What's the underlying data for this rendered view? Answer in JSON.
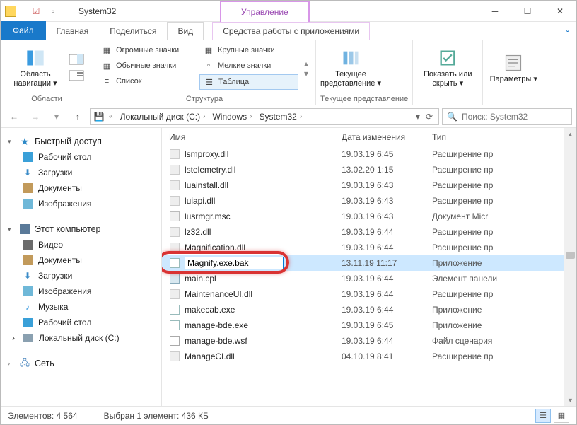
{
  "title": {
    "app_name": "System32",
    "context_group": "Управление",
    "context_tab": "Средства работы с приложениями"
  },
  "tabs": {
    "file": "Файл",
    "home": "Главная",
    "share": "Поделиться",
    "view": "Вид"
  },
  "ribbon": {
    "panes_group_label": "Области",
    "panes_btn": "Область навигации",
    "layout_group_label": "Структура",
    "layouts": {
      "huge": "Огромные значки",
      "large": "Крупные значки",
      "medium": "Обычные значки",
      "small": "Мелкие значки",
      "list": "Список",
      "table": "Таблица"
    },
    "currentview_group_label": "Текущее представление",
    "currentview_btn": "Текущее представление",
    "showhide_btn": "Показать или скрыть",
    "options_btn": "Параметры"
  },
  "breadcrumb": {
    "drive": "Локальный диск (C:)",
    "p1": "Windows",
    "p2": "System32"
  },
  "search": {
    "placeholder": "Поиск: System32"
  },
  "nav": {
    "quick": "Быстрый доступ",
    "quick_items": {
      "desktop": "Рабочий стол",
      "downloads": "Загрузки",
      "documents": "Документы",
      "pictures": "Изображения"
    },
    "thispc": "Этот компьютер",
    "pc_items": {
      "videos": "Видео",
      "documents": "Документы",
      "downloads": "Загрузки",
      "pictures": "Изображения",
      "music": "Музыка",
      "desktop": "Рабочий стол",
      "cdrive": "Локальный диск (C:)"
    },
    "network": "Сеть"
  },
  "columns": {
    "name": "Имя",
    "date": "Дата изменения",
    "type": "Тип"
  },
  "files": [
    {
      "name": "lsmproxy.dll",
      "date": "19.03.19 6:45",
      "type": "Расширение пр",
      "icon": "dll"
    },
    {
      "name": "lstelemetry.dll",
      "date": "13.02.20 1:15",
      "type": "Расширение пр",
      "icon": "dll"
    },
    {
      "name": "luainstall.dll",
      "date": "19.03.19 6:43",
      "type": "Расширение пр",
      "icon": "dll"
    },
    {
      "name": "luiapi.dll",
      "date": "19.03.19 6:43",
      "type": "Расширение пр",
      "icon": "dll"
    },
    {
      "name": "lusrmgr.msc",
      "date": "19.03.19 6:43",
      "type": "Документ Micr",
      "icon": "msc"
    },
    {
      "name": "lz32.dll",
      "date": "19.03.19 6:44",
      "type": "Расширение пр",
      "icon": "dll"
    },
    {
      "name": "Magnification.dll",
      "date": "19.03.19 6:44",
      "type": "Расширение пр",
      "icon": "dll"
    },
    {
      "name": "Magnify.exe.bak",
      "date": "13.11.19 11:17",
      "type": "Приложение",
      "icon": "exe",
      "renaming": true,
      "selected": true,
      "highlight": true
    },
    {
      "name": "main.cpl",
      "date": "19.03.19 6:44",
      "type": "Элемент панели",
      "icon": "cpl"
    },
    {
      "name": "MaintenanceUI.dll",
      "date": "19.03.19 6:44",
      "type": "Расширение пр",
      "icon": "dll"
    },
    {
      "name": "makecab.exe",
      "date": "19.03.19 6:44",
      "type": "Приложение",
      "icon": "exe"
    },
    {
      "name": "manage-bde.exe",
      "date": "19.03.19 6:45",
      "type": "Приложение",
      "icon": "exe"
    },
    {
      "name": "manage-bde.wsf",
      "date": "19.03.19 6:44",
      "type": "Файл сценария",
      "icon": "wsf"
    },
    {
      "name": "ManageCI.dll",
      "date": "04.10.19 8:41",
      "type": "Расширение пр",
      "icon": "dll"
    }
  ],
  "status": {
    "count_label": "Элементов:",
    "count": "4 564",
    "sel_label": "Выбран 1 элемент:",
    "sel_size": "436 КБ"
  }
}
